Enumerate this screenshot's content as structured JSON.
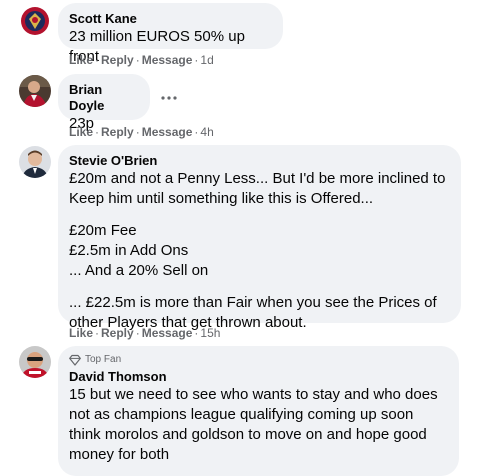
{
  "actions": {
    "like": "Like",
    "reply": "Reply",
    "message": "Message",
    "separator": "·"
  },
  "comments": [
    {
      "author": "Scott Kane",
      "lines": [
        "23 million EUROS 50% up front"
      ],
      "time": "1d"
    },
    {
      "author": "Brian Doyle",
      "lines": [
        "23p"
      ],
      "time": "4h"
    },
    {
      "author": "Stevie O'Brien",
      "paragraphs": [
        [
          "£20m and not a Penny Less... But I'd be more inclined to",
          "Keep him until something like this is Offered..."
        ],
        [
          "£20m Fee",
          "£2.5m in Add Ons",
          "... And a 20% Sell on"
        ],
        [
          "... £22.5m is more than Fair when you see the Prices of",
          "other Players that get thrown about."
        ]
      ],
      "time": "15h"
    },
    {
      "badge": "Top Fan",
      "author": "David Thomson",
      "lines": [
        "15 but we need to see who wants to stay and who does",
        "not as champions league qualifying coming up soon",
        "think morolos and goldson to move on and hope good",
        "money for both"
      ]
    }
  ],
  "icons": {
    "more": "more-horizontal-icon",
    "top_fan": "diamond-icon"
  }
}
